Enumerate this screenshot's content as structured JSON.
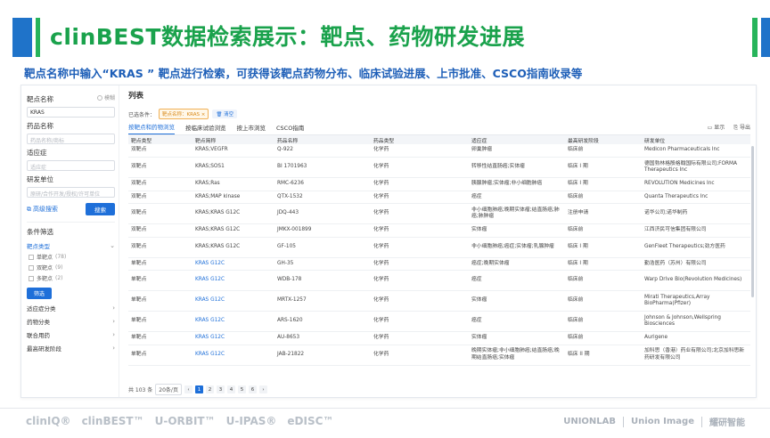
{
  "header": {
    "title": "clinBEST数据检索展示：靶点、药物研发进展",
    "subtitle": "靶点名称中输入“KRAS ” 靶点进行检索，可获得该靶点药物分布、临床试验进展、上市批准、CSCO指南收录等"
  },
  "sidebar": {
    "target_label": "靶点名称",
    "fuzzy_label": "模糊",
    "target_value": "KRAS",
    "drug_label": "药品名称",
    "drug_placeholder": "药品名称/商标",
    "indication_label": "适应症",
    "indication_placeholder": "适应症",
    "org_label": "研发单位",
    "org_placeholder": "原研/合作开发/授权/许可单位",
    "advanced_search": "高级搜索",
    "search_button": "搜索",
    "filter_title": "条件筛选",
    "target_type_group": "靶点类型",
    "checks": [
      {
        "label": "单靶点",
        "count": "(78)"
      },
      {
        "label": "双靶点",
        "count": "(9)"
      },
      {
        "label": "多靶点",
        "count": "(2)"
      }
    ],
    "filter_button": "筛选",
    "groups": [
      "适应症分类",
      "药物分类",
      "联合用药",
      "最高研发阶段"
    ]
  },
  "main": {
    "title": "列表",
    "selected_label": "已选条件：",
    "selected_tag": "靶点名称：KRAS ×",
    "clear_label": "清空",
    "tabs": [
      "按靶点和药物浏览",
      "按临床试验浏览",
      "按上市浏览",
      "CSCO指南"
    ],
    "display_label": "显示",
    "export_label": "导出",
    "columns": [
      "靶点类型",
      "靶点简称",
      "药品名称",
      "药品类型",
      "适应症",
      "最高研发阶段",
      "研发单位"
    ],
    "rows": [
      {
        "type": "双靶点",
        "target": "KRAS;VEGFR",
        "drug": "Q-922",
        "drug_type": "化学药",
        "indication": "卵巢肿瘤",
        "stage": "临床前",
        "org": "Medicon Pharmaceuticals Inc"
      },
      {
        "type": "双靶点",
        "target": "KRAS;SOS1",
        "drug": "BI 1701963",
        "drug_type": "化学药",
        "indication": "转移性结直肠癌;实体瘤",
        "stage": "临床 I 期",
        "org": "德国勃林格殷格翰国际有限公司;FORMA Therapeutics Inc"
      },
      {
        "type": "双靶点",
        "target": "KRAS;Ras",
        "drug": "RMC-6236",
        "drug_type": "化学药",
        "indication": "胰腺肿瘤;实体瘤;非小细胞肺癌",
        "stage": "临床 I 期",
        "org": "REVOLUTION Medicines Inc"
      },
      {
        "type": "双靶点",
        "target": "KRAS;MAP kinase",
        "drug": "QTX-1532",
        "drug_type": "化学药",
        "indication": "癌症",
        "stage": "临床前",
        "org": "Quanta Therapeutics Inc"
      },
      {
        "type": "双靶点",
        "target": "KRAS;KRAS G12C",
        "drug": "JDQ-443",
        "drug_type": "化学药",
        "indication": "非小细胞肺癌;晚期实体瘤;结直肠癌;肺癌;肺肿瘤",
        "stage": "注册申请",
        "org": "诺华公司;诺华制药"
      },
      {
        "type": "双靶点",
        "target": "KRAS;KRAS G12C",
        "drug": "JMKX-001899",
        "drug_type": "化学药",
        "indication": "实体瘤",
        "stage": "临床前",
        "org": "江西济民可信集团有限公司"
      },
      {
        "type": "双靶点",
        "target": "KRAS;KRAS G12C",
        "drug": "GF-105",
        "drug_type": "化学药",
        "indication": "非小细胞肺癌;癌症;实体瘤;乳腺肿瘤",
        "stage": "临床 I 期",
        "org": "GenFleet Therapeutics;劲方医药"
      },
      {
        "type": "单靶点",
        "target": "KRAS G12C",
        "drug": "GH-35",
        "drug_type": "化学药",
        "indication": "癌症;晚期实体瘤",
        "stage": "临床 I 期",
        "org": "勤浩医药（苏州）有限公司"
      },
      {
        "type": "单靶点",
        "target": "KRAS G12C",
        "drug": "WDB-178",
        "drug_type": "化学药",
        "indication": "癌症",
        "stage": "临床前",
        "org": "Warp Drive Bio(Revolution Medicines)"
      },
      {
        "type": "单靶点",
        "target": "KRAS G12C",
        "drug": "MRTX-1257",
        "drug_type": "化学药",
        "indication": "实体瘤",
        "stage": "临床前",
        "org": "Mirati Therapeutics,Array BioPharma(Pfizer)"
      },
      {
        "type": "单靶点",
        "target": "KRAS G12C",
        "drug": "ARS-1620",
        "drug_type": "化学药",
        "indication": "癌症",
        "stage": "临床前",
        "org": "Johnson & Johnson,Wellspring Biosciences"
      },
      {
        "type": "单靶点",
        "target": "KRAS G12C",
        "drug": "AU-8653",
        "drug_type": "化学药",
        "indication": "实体瘤",
        "stage": "临床前",
        "org": "Aurigene"
      },
      {
        "type": "单靶点",
        "target": "KRAS G12C",
        "drug": "JAB-21822",
        "drug_type": "化学药",
        "indication": "晚期实体瘤;非小细胞肺癌;结直肠癌;晚期结直肠癌;实体瘤",
        "stage": "临床 II 期",
        "org": "加科思（香港）药业有限公司;北京加科思新药研发有限公司"
      }
    ],
    "pager": {
      "total": "共 103 条",
      "page_size": "20条/页",
      "prev": "‹",
      "pages": [
        "1",
        "2",
        "3",
        "4",
        "5",
        "6"
      ],
      "next": "›"
    }
  },
  "footer": {
    "left_brands": [
      "clinIQ®",
      "clinBEST™",
      "U-ORBIT™",
      "U-IPAS®",
      "eDISC™"
    ],
    "right_brands": [
      "UNIONLAB",
      "Union Image",
      "耀研智能"
    ]
  },
  "colors": {
    "accent_blue": "#1e6fd9",
    "title_green": "#1aa24c",
    "tag_orange": "#f0b056"
  }
}
